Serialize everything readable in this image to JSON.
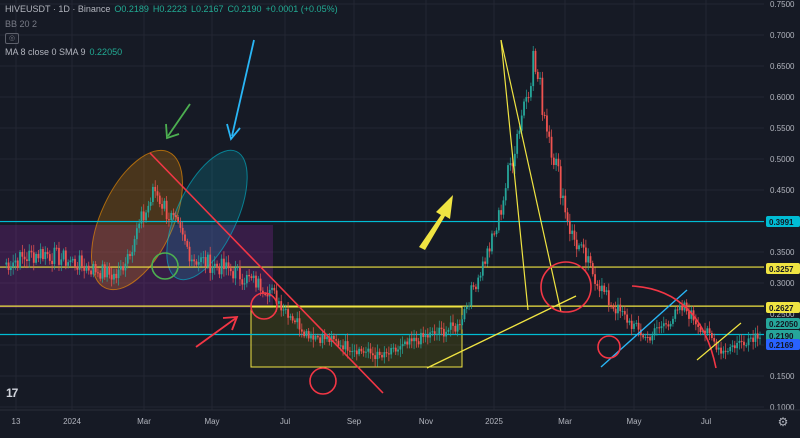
{
  "symbol_line": {
    "symbol": "HIVEUSDT · 1D · Binance",
    "open": "O0.2189",
    "high": "H0.2223",
    "low": "L0.2167",
    "close": "C0.2190",
    "change": "+0.0001 (+0.05%)"
  },
  "indicators": [
    {
      "label": "BB 20 2",
      "value": ""
    },
    {
      "label": "MA 8 close 0 SMA 9",
      "value": "0.22050"
    }
  ],
  "colors": {
    "background": "#161a25",
    "up": "#26a69a",
    "down": "#ef5350",
    "cyan_line": "#00bcd4",
    "yellow_line": "#f0e442",
    "red_drawing": "#f23645"
  },
  "chart_data": {
    "type": "line",
    "title": "",
    "xlabel": "",
    "ylabel": "",
    "x_ticks": [
      "13",
      "2024",
      "Mar",
      "May",
      "Jul",
      "Sep",
      "Nov",
      "2025",
      "Mar",
      "May",
      "Jul"
    ],
    "y_ticks": [
      "0.7500",
      "0.7000",
      "0.6500",
      "0.6000",
      "0.5500",
      "0.5000",
      "0.4500",
      "0.4000",
      "0.3500",
      "0.3000",
      "0.2500",
      "0.2000",
      "0.1500",
      "0.1000"
    ],
    "ylim": [
      0.09,
      0.76
    ],
    "x": [
      "2023-11",
      "2023-12",
      "2024-01",
      "2024-02",
      "2024-03",
      "2024-04",
      "2024-05",
      "2024-06",
      "2024-07",
      "2024-08",
      "2024-09",
      "2024-10",
      "2024-11",
      "2024-12",
      "2025-01",
      "2025-02",
      "2025-03",
      "2025-04",
      "2025-05",
      "2025-06",
      "2025-07"
    ],
    "series": [
      {
        "values": [
          0.33,
          0.35,
          0.33,
          0.31,
          0.45,
          0.34,
          0.32,
          0.29,
          0.22,
          0.2,
          0.18,
          0.21,
          0.23,
          0.38,
          0.66,
          0.38,
          0.27,
          0.21,
          0.26,
          0.19,
          0.22
        ]
      }
    ],
    "price_labels": [
      {
        "value": "0.3991",
        "color": "#00bcd4"
      },
      {
        "value": "0.3257",
        "color": "#f0e442"
      },
      {
        "value": "0.2627",
        "color": "#f0e442"
      },
      {
        "value": "0.22050",
        "color": "#26a69a"
      },
      {
        "value": "0.2190",
        "color": "#26a69a"
      },
      {
        "value": "0.2169",
        "color": "#2962ff"
      }
    ],
    "horizontal_lines": [
      {
        "value": 0.3991,
        "color": "#00bcd4"
      },
      {
        "value": 0.3257,
        "color": "#f0e442"
      },
      {
        "value": 0.2627,
        "color": "#f0e442"
      },
      {
        "value": 0.2169,
        "color": "#00bcd4"
      }
    ]
  }
}
